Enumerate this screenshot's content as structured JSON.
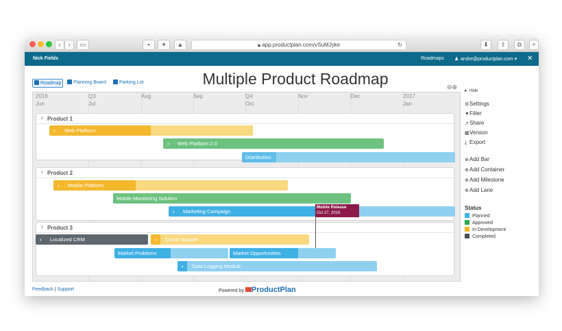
{
  "browser": {
    "url": "app.productplan.com/vSuMJyke"
  },
  "appbar": {
    "user": "Nick Fields",
    "roadmaps": "Roadmaps",
    "account": "andre@productplan.com ▾"
  },
  "tabs": [
    "Roadmap",
    "Planning Board",
    "Parking Lot"
  ],
  "page_title": "Multiple Product Roadmap",
  "timeline": [
    {
      "top": "2016",
      "bottom": "Jun"
    },
    {
      "top": "Q3",
      "bottom": "Jul"
    },
    {
      "top": "",
      "bottom": "Aug"
    },
    {
      "top": "",
      "bottom": "Sep"
    },
    {
      "top": "Q4",
      "bottom": "Oct"
    },
    {
      "top": "",
      "bottom": "Nov"
    },
    {
      "top": "",
      "bottom": "Dec"
    },
    {
      "top": "2017",
      "bottom": "Jan"
    }
  ],
  "products": [
    {
      "name": "Product 1",
      "bars": [
        {
          "label": "Web Platform",
          "status": "In Development"
        },
        {
          "label": "Web Platform 2.0",
          "status": "Approved"
        },
        {
          "label": "Distribution",
          "status": "Planned"
        }
      ]
    },
    {
      "name": "Product 2",
      "bars": [
        {
          "label": "Mobile Platform",
          "status": "In Development"
        },
        {
          "label": "Mobile Monitoring Solution",
          "status": "Approved"
        },
        {
          "label": "Marketing Campaign",
          "status": "Planned"
        }
      ]
    },
    {
      "name": "Product 3",
      "bars": [
        {
          "label": "Localized CRM",
          "status": "Completed"
        },
        {
          "label": "Cloud Support",
          "status": "In Development"
        },
        {
          "label": "Market Problems",
          "status": "Planned"
        },
        {
          "label": "Market Opportunities",
          "status": "Planned"
        },
        {
          "label": "Data Logging Module",
          "status": "Planned"
        }
      ]
    }
  ],
  "milestone": {
    "title": "Mobile Release",
    "date": "Oct 27, 2016"
  },
  "sidebar": {
    "hide": "Hide",
    "actions": [
      "Settings",
      "Filter",
      "Share",
      "Version",
      "Export"
    ],
    "add_actions": [
      "Add Bar",
      "Add Container",
      "Add Milestone",
      "Add Lane"
    ]
  },
  "legend": {
    "title": "Status",
    "items": [
      {
        "label": "Planned",
        "color": "#3fb0e3"
      },
      {
        "label": "Approved",
        "color": "#2fa84f"
      },
      {
        "label": "In Development",
        "color": "#f4b82d"
      },
      {
        "label": "Completed",
        "color": "#4a4f54"
      }
    ]
  },
  "footer": {
    "feedback": "Feedback",
    "sep": "|",
    "support": "Support",
    "powered_by": "Powered by",
    "brand": "ProductPlan"
  }
}
